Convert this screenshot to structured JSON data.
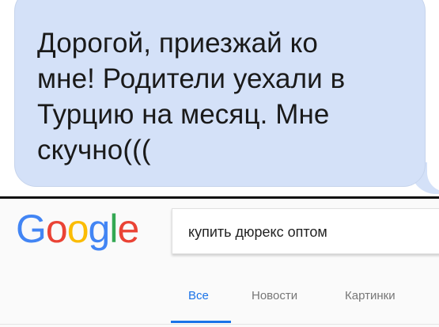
{
  "message": {
    "lines": [
      "Дорогой, приезжай ко",
      "мне! Родители уехали в",
      "Турцию на месяц. Мне",
      "скучно((("
    ],
    "bubble_color": "#d4e1f8"
  },
  "google": {
    "logo": {
      "letters": [
        "G",
        "o",
        "o",
        "g",
        "l",
        "e"
      ],
      "colors": [
        "#4285f4",
        "#ea4335",
        "#fbbc05",
        "#4285f4",
        "#34a853",
        "#ea4335"
      ]
    },
    "search_query": "купить дюрекс оптом",
    "tabs": [
      {
        "label": "Все",
        "active": true
      },
      {
        "label": "Новости",
        "active": false
      },
      {
        "label": "Картинки",
        "active": false
      }
    ],
    "accent_color": "#1a73e8"
  }
}
